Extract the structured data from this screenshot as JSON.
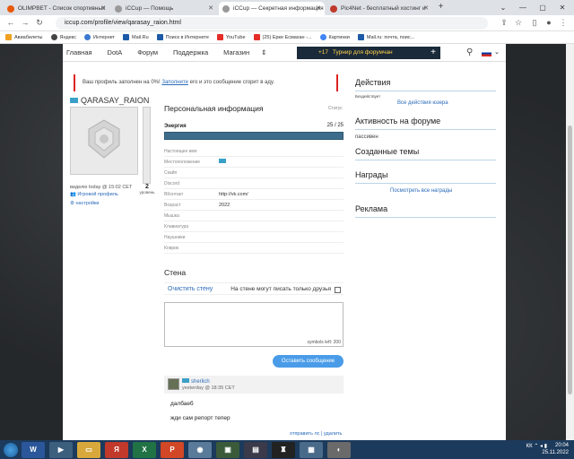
{
  "browser": {
    "tabs": [
      {
        "title": "OLIMPBET - Список спортивных",
        "color": "#e8590c"
      },
      {
        "title": "iCCup — Помощь",
        "color": "#888888"
      },
      {
        "title": "iCCup — Секретная информация",
        "color": "#888888"
      },
      {
        "title": "Pic4Net - бесплатный хостинг и",
        "color": "#c0392b"
      }
    ],
    "address": "iccup.com/profile/view/qarasay_raion.html",
    "bookmarks": [
      "Авиабилеты",
      "Яндекс",
      "Интернет",
      "Mail.Ru",
      "Поиск в Интернете",
      "YouTube",
      "(25) Ерке Есмахан -...",
      "Картинки",
      "Mail.ru: почта, поис..."
    ]
  },
  "site": {
    "nav": [
      "Главная",
      "DotA",
      "Форум",
      "Поддержка",
      "Магазин"
    ],
    "promo": {
      "count": "+17",
      "text": "Турнир для форумчан"
    }
  },
  "warning": {
    "before": "Ваш профиль заполнен на 0%!",
    "link": "Заполните",
    "after": "его и это сообщение сгорит в аду."
  },
  "user": {
    "name": "QARASAY_RAION",
    "seen": "виделю today @ 15:02 CET",
    "level": "2",
    "level_label": "уровень",
    "game_profile": "Игровой профиль",
    "settings": "настройки"
  },
  "personal": {
    "title": "Персональная информация",
    "status": "Статус",
    "energy_label": "Энергия",
    "energy_value": "25 / 25",
    "fields": [
      {
        "label": "Настоящее имя",
        "value": ""
      },
      {
        "label": "Местоположение",
        "value": ""
      },
      {
        "label": "Скайп",
        "value": ""
      },
      {
        "label": "Discord",
        "value": ""
      },
      {
        "label": "ВКонтакт",
        "value": "http://vk.com/"
      },
      {
        "label": "Возраст",
        "value": "2022"
      },
      {
        "label": "Мышка",
        "value": ""
      },
      {
        "label": "Клавиатура",
        "value": ""
      },
      {
        "label": "Наушники",
        "value": ""
      },
      {
        "label": "Коврик",
        "value": ""
      }
    ]
  },
  "wall": {
    "title": "Стена",
    "clear": "Очистить стену",
    "only_friends": "На стене могут писать только друзья",
    "symbols_left": "symbols left: 200",
    "send": "Оставить сообщение",
    "post": {
      "author": "sherlich",
      "date": "yesterday @ 18:35 CET",
      "lines": [
        "далбаеб",
        "жди сам репорт тепер"
      ]
    },
    "footer_links": [
      "отправить лс",
      "удалить"
    ]
  },
  "right": {
    "actions_title": "Действия",
    "actions_note": "Бездействует",
    "all_actions": "Все действия юзера",
    "forum_title": "Активность на форуме",
    "forum_text": "пассивен",
    "themes_title": "Созданные темы",
    "awards_title": "Награды",
    "all_awards": "Посмотреть все награды",
    "ads_title": "Реклама"
  },
  "taskbar": {
    "lang": "КК",
    "time": "20:04",
    "date": "25.11.2022"
  }
}
